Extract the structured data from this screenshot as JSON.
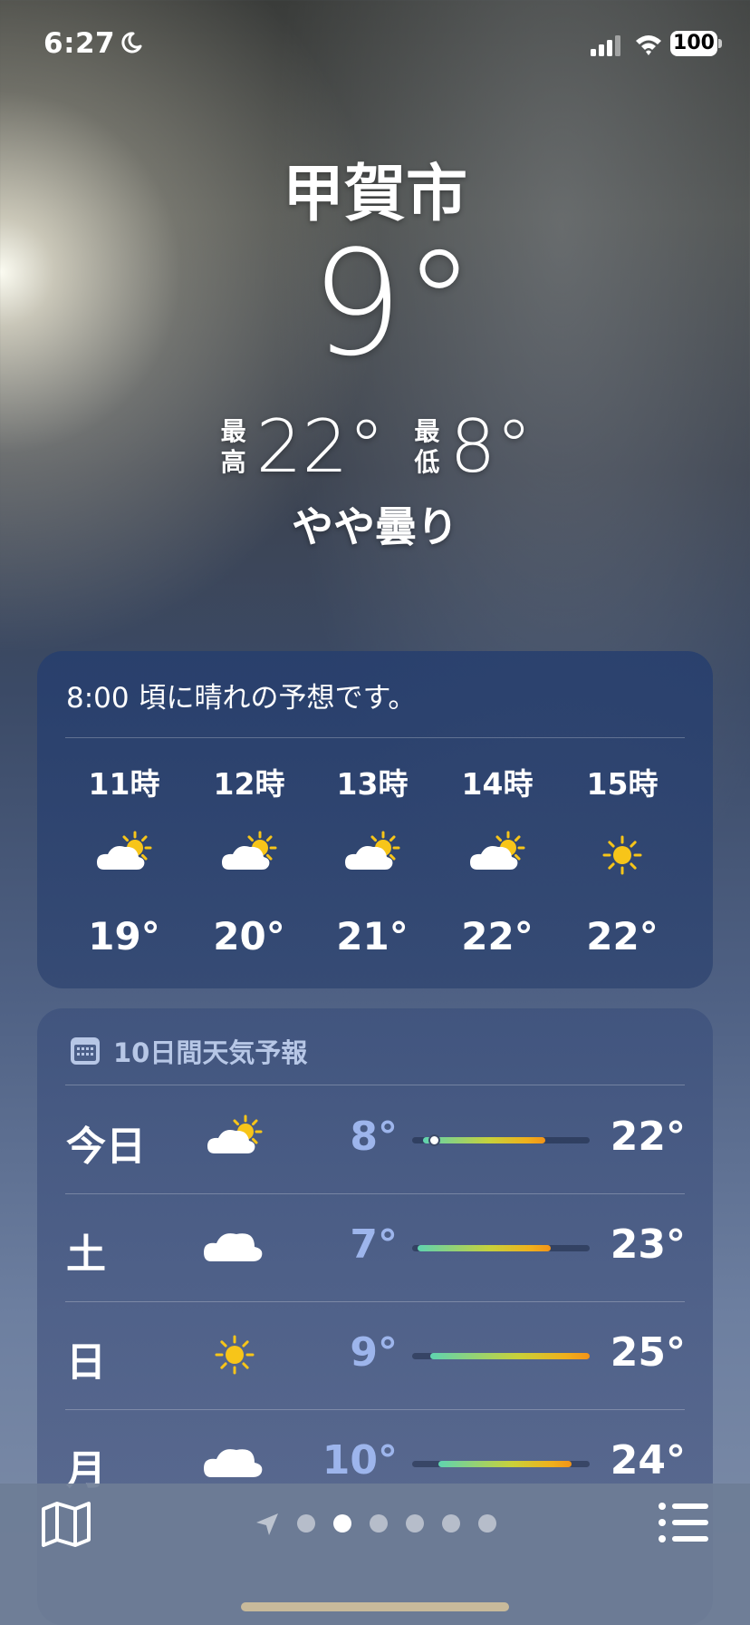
{
  "status_bar": {
    "time": "6:27",
    "battery": "100"
  },
  "header": {
    "city": "甲賀市",
    "temperature": "9°",
    "high_label": "最\n高",
    "high": "22°",
    "low_label": "最\n低",
    "low": "8°",
    "condition": "やや曇り"
  },
  "hourly": {
    "summary": "8:00 頃に晴れの予想です。",
    "hours": [
      {
        "label": "11時",
        "icon": "partly-sunny-icon",
        "temp": "19°"
      },
      {
        "label": "12時",
        "icon": "partly-sunny-icon",
        "temp": "20°"
      },
      {
        "label": "13時",
        "icon": "partly-sunny-icon",
        "temp": "21°"
      },
      {
        "label": "14時",
        "icon": "partly-sunny-icon",
        "temp": "22°"
      },
      {
        "label": "15時",
        "icon": "sun-icon",
        "temp": "22°"
      }
    ]
  },
  "daily": {
    "title": "10日間天気予報",
    "days": [
      {
        "name": "今日",
        "icon": "partly-sunny-icon",
        "low": "8°",
        "high": "22°",
        "range_start": 0.06,
        "range_end": 0.75,
        "current_marker": 0.12
      },
      {
        "name": "土",
        "icon": "cloud-icon",
        "low": "7°",
        "high": "23°",
        "range_start": 0.03,
        "range_end": 0.78
      },
      {
        "name": "日",
        "icon": "sun-icon",
        "low": "9°",
        "high": "25°",
        "range_start": 0.1,
        "range_end": 1.0
      },
      {
        "name": "月",
        "icon": "cloud-icon",
        "low": "10°",
        "high": "24°",
        "range_start": 0.15,
        "range_end": 0.9
      }
    ]
  },
  "toolbar": {
    "page_count": 6,
    "active_page": 1
  },
  "colors": {
    "sun": "#f7c519",
    "low_temp": "#9db5ec",
    "bar_cool": "#5fd3b0",
    "bar_mid": "#c8d13a",
    "bar_warm": "#f0b01c",
    "bar_hot": "#f29318"
  }
}
